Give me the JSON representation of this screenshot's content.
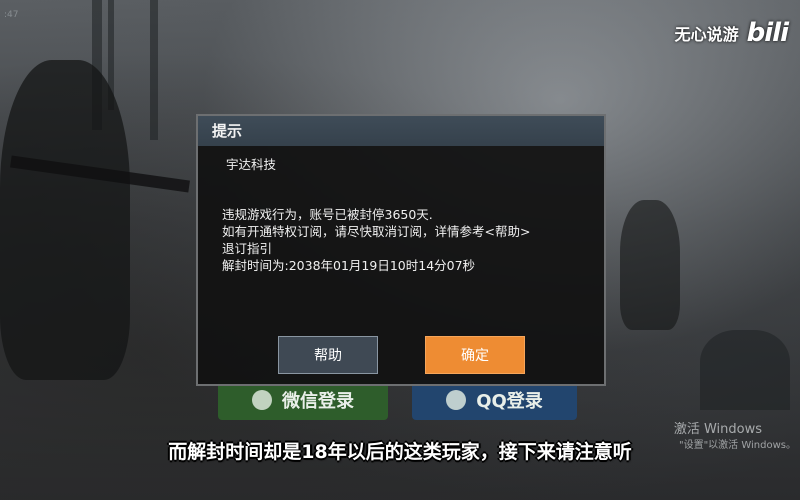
{
  "watermark": {
    "channel": "无心说游",
    "logo": "bili"
  },
  "dialog": {
    "title": "提示",
    "company": "宇达科技",
    "lines": [
      "违规游戏行为，账号已被封停3650天.",
      "如有开通特权订阅，请尽快取消订阅，详情参考<帮助>",
      "退订指引",
      "解封时间为:2038年01月19日10时14分07秒"
    ],
    "buttons": {
      "help": "帮助",
      "ok": "确定"
    }
  },
  "background": {
    "login": {
      "wechat": "微信登录",
      "qq": "QQ登录"
    },
    "windows_activation": {
      "title": "激活 Windows",
      "subtitle": "\"设置\"以激活 Windows。"
    }
  },
  "subtitle": "而解封时间却是18年以后的这类玩家，接下来请注意听",
  "colors": {
    "ok_button": "#ee8c33",
    "help_button": "#3f4954",
    "dialog_header": "#3f4c58"
  }
}
